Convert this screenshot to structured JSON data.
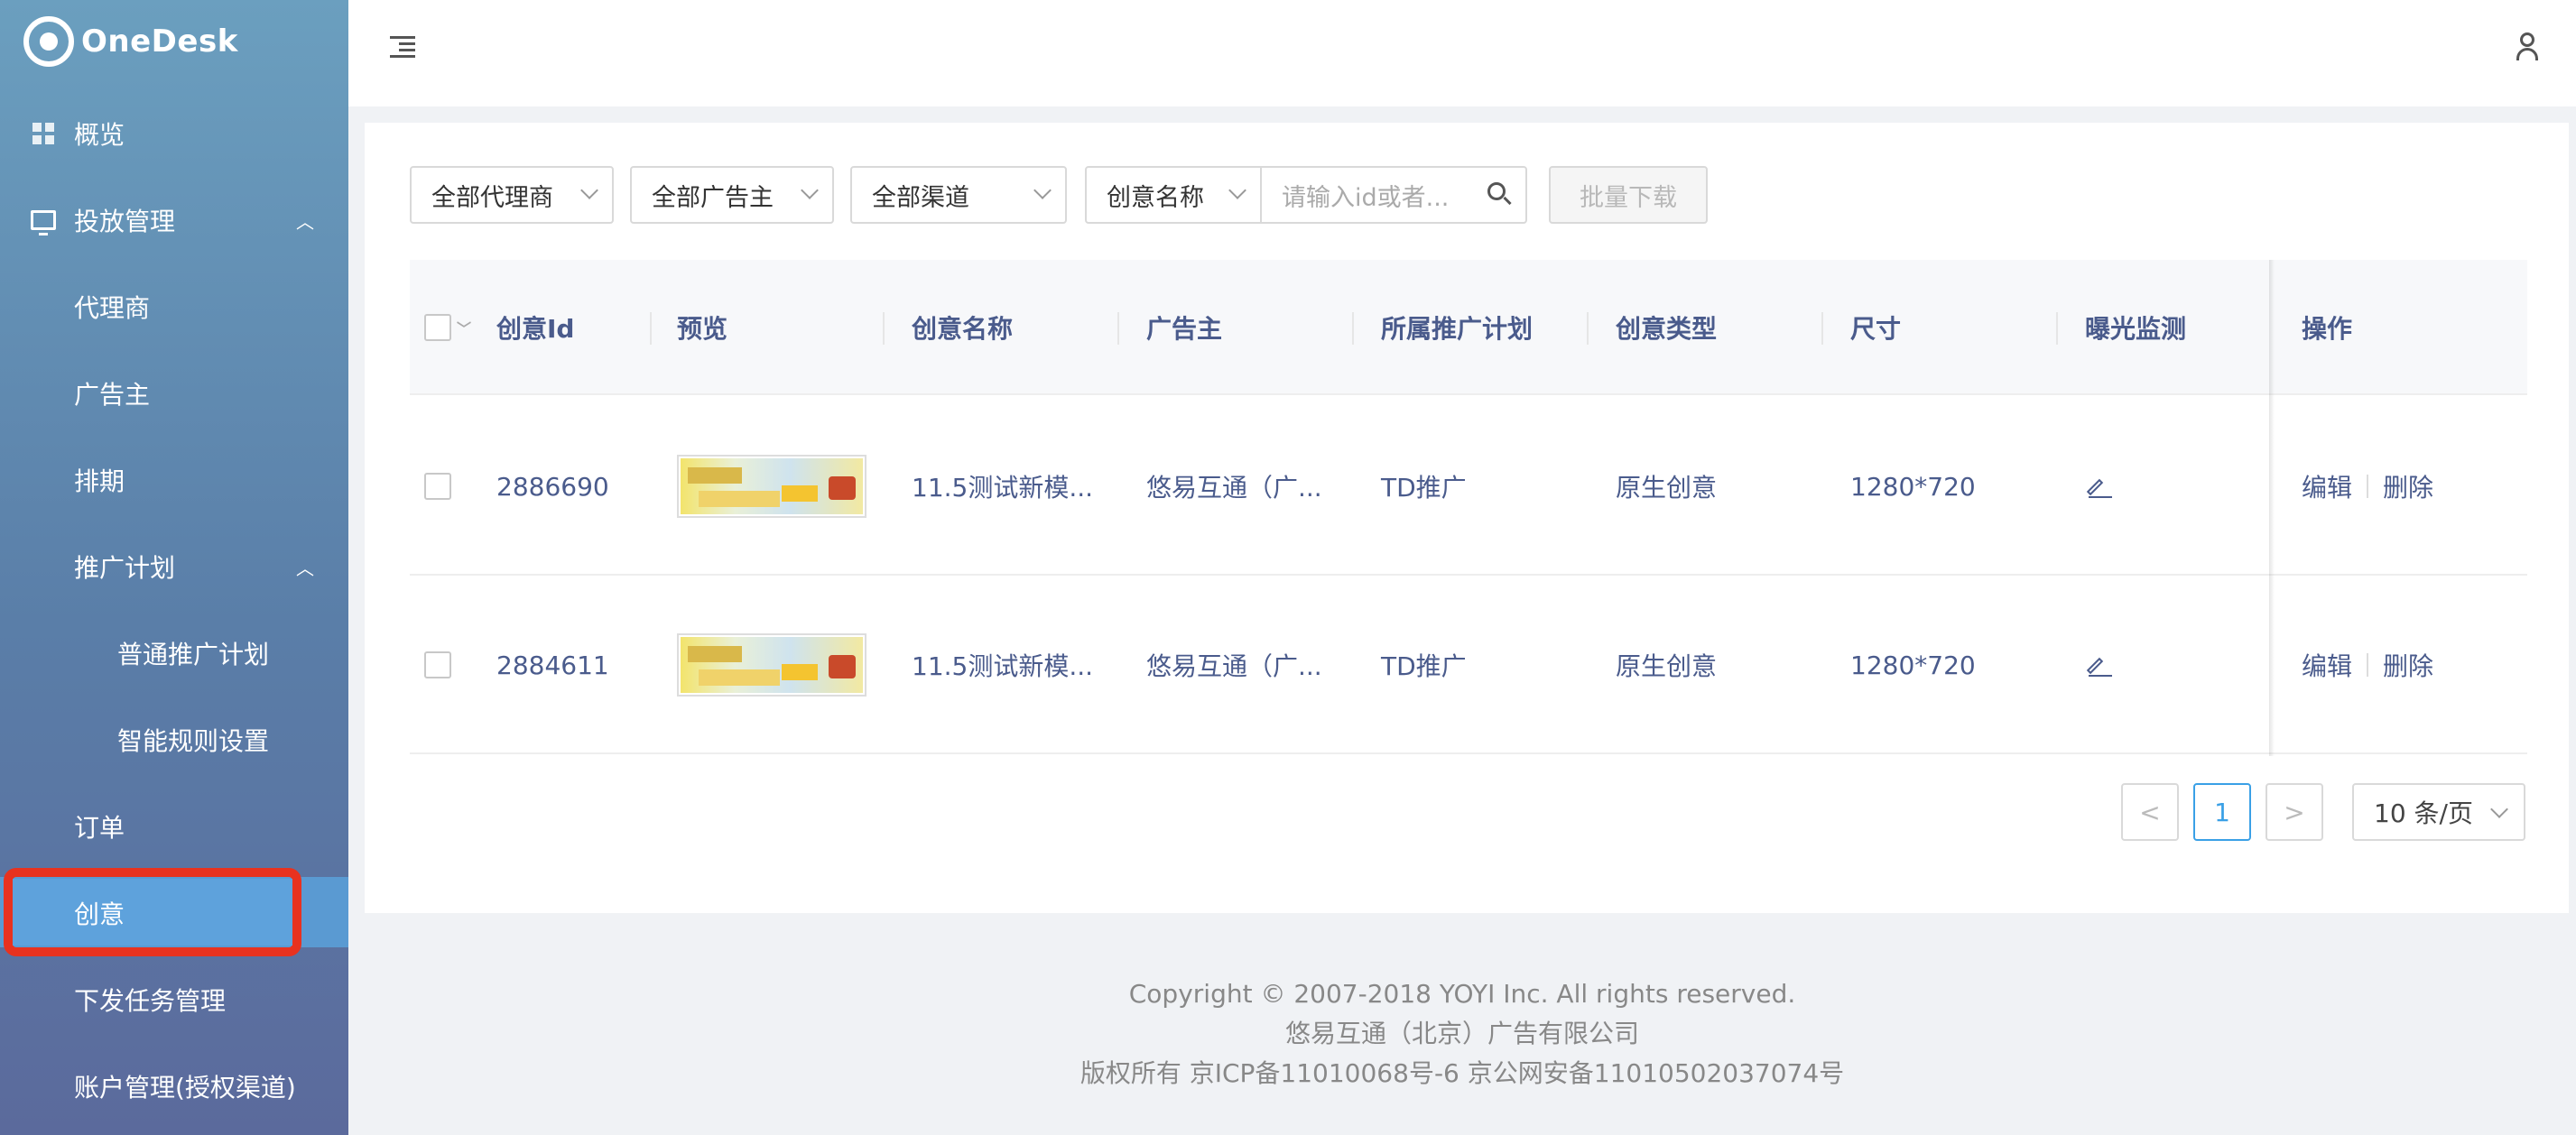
{
  "app": {
    "logo_text": "OneDesk"
  },
  "sidebar": {
    "items": [
      {
        "label": "概览",
        "icon": "dashboard-grid-icon"
      },
      {
        "label": "投放管理",
        "icon": "monitor-icon",
        "expanded": true
      },
      {
        "label": "代理商"
      },
      {
        "label": "广告主"
      },
      {
        "label": "排期"
      },
      {
        "label": "推广计划",
        "expanded": true
      },
      {
        "label": "普通推广计划"
      },
      {
        "label": "智能规则设置"
      },
      {
        "label": "订单"
      },
      {
        "label": "创意",
        "active": true
      },
      {
        "label": "下发任务管理"
      },
      {
        "label": "账户管理(授权渠道)"
      }
    ]
  },
  "filters": {
    "agency": "全部代理商",
    "advertiser": "全部广告主",
    "channel": "全部渠道",
    "search_field": "创意名称",
    "search_placeholder": "请输入id或者...",
    "batch_download": "批量下载"
  },
  "table": {
    "columns": [
      "创意Id",
      "预览",
      "创意名称",
      "广告主",
      "所属推广计划",
      "创意类型",
      "尺寸",
      "曝光监测",
      "操作"
    ],
    "rows": [
      {
        "id": "2886690",
        "name": "11.5测试新模...",
        "advertiser": "悠易互通（广...",
        "plan": "TD推广",
        "type": "原生创意",
        "size": "1280*720",
        "edit": "编辑",
        "delete": "删除"
      },
      {
        "id": "2884611",
        "name": "11.5测试新模...",
        "advertiser": "悠易互通（广...",
        "plan": "TD推广",
        "type": "原生创意",
        "size": "1280*720",
        "edit": "编辑",
        "delete": "删除"
      }
    ]
  },
  "pagination": {
    "prev": "<",
    "current": "1",
    "next": ">",
    "page_size": "10 条/页"
  },
  "footer": {
    "copyright": "Copyright © 2007-2018 YOYI Inc. All rights reserved.",
    "company": "悠易互通（北京）广告有限公司",
    "icp": "版权所有 京ICP备11010068号-6 京公网安备11010502037074号"
  },
  "colors": {
    "accent": "#3aa0e6",
    "highlight_border": "#e8321f",
    "link_text": "#4a5b8c"
  }
}
